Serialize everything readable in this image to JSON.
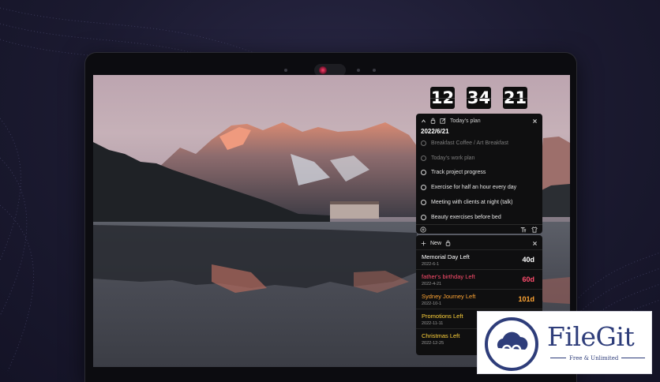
{
  "clock": {
    "hours": "12",
    "minutes": "34",
    "seconds": "21"
  },
  "plan": {
    "title": "Today's plan",
    "date": "2022/6/21",
    "tasks": [
      {
        "label": "Breakfast Coffee / Art Breakfast",
        "done": true
      },
      {
        "label": "Today's work plan",
        "done": true
      },
      {
        "label": "Track project progress",
        "done": false
      },
      {
        "label": "Exercise for half an hour every day",
        "done": false
      },
      {
        "label": "Meeting with clients at night (talk)",
        "done": false
      },
      {
        "label": "Beauty exercises before bed",
        "done": false
      }
    ]
  },
  "countdown": {
    "new_label": "New",
    "items": [
      {
        "name": "Memorial Day Left",
        "date": "2022-6-1",
        "days": "40d",
        "color": "#ffffff"
      },
      {
        "name": "father's birthday Left",
        "date": "2022-4-21",
        "days": "60d",
        "color": "#ff4d6d"
      },
      {
        "name": "Sydney Journey Left",
        "date": "2022-10-1",
        "days": "101d",
        "color": "#ffa534"
      },
      {
        "name": "Promotions Left",
        "date": "2022-11-11",
        "days": "",
        "color": "#ffd23a"
      },
      {
        "name": "Christmas Left",
        "date": "2022-12-25",
        "days": "",
        "color": "#ffd23a"
      }
    ]
  },
  "badge": {
    "title": "FileGit",
    "subtitle": "Free & Unlimited"
  },
  "colors": {
    "panel_bg": "#0f0f10",
    "brand": "#2e3d7a",
    "accent_red": "#ff4d6d",
    "accent_orange": "#ffa534",
    "accent_yellow": "#ffd23a"
  },
  "icons": [
    "chevron-up-icon",
    "lock-icon",
    "edit-icon",
    "close-icon",
    "add-icon",
    "text-size-icon",
    "shirt-icon",
    "plus-icon"
  ]
}
